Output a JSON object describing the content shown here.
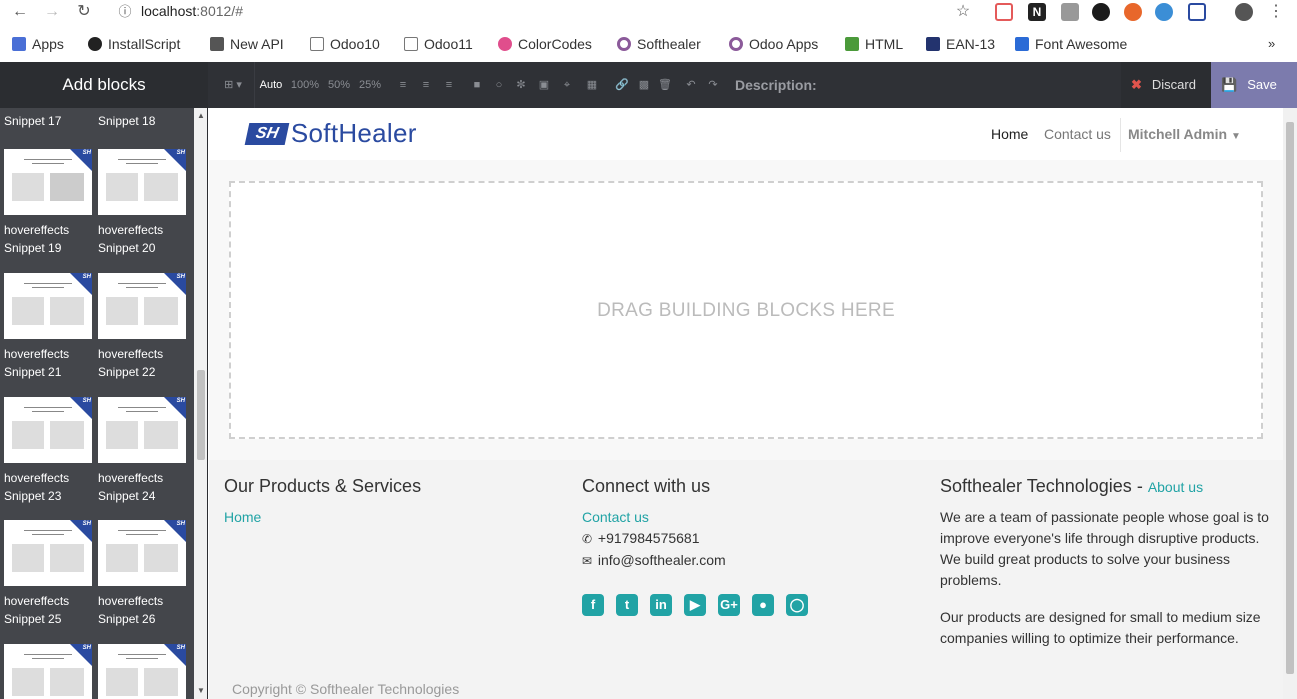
{
  "browser": {
    "url_host": "localhost",
    "url_path": ":8012/#",
    "bookmarks": [
      "Apps",
      "InstallScript",
      "New API",
      "Odoo10",
      "Odoo11",
      "ColorCodes",
      "Softhealer",
      "Odoo Apps",
      "HTML",
      "EAN-13",
      "Font Awesome"
    ]
  },
  "editor": {
    "add_blocks": "Add blocks",
    "size_auto": "Auto",
    "size_100": "100%",
    "size_50": "50%",
    "size_25": "25%",
    "description_label": "Description:",
    "discard": "Discard",
    "save": "Save"
  },
  "snippets": [
    {
      "l1": "hovereffects",
      "l2": "Snippet 17"
    },
    {
      "l1": "hovereffects",
      "l2": "Snippet 18"
    },
    {
      "l1": "hovereffects",
      "l2": "Snippet 19"
    },
    {
      "l1": "hovereffects",
      "l2": "Snippet 20"
    },
    {
      "l1": "hovereffects",
      "l2": "Snippet 21"
    },
    {
      "l1": "hovereffects",
      "l2": "Snippet 22"
    },
    {
      "l1": "hovereffects",
      "l2": "Snippet 23"
    },
    {
      "l1": "hovereffects",
      "l2": "Snippet 24"
    },
    {
      "l1": "hovereffects",
      "l2": "Snippet 25"
    },
    {
      "l1": "hovereffects",
      "l2": "Snippet 26"
    }
  ],
  "site": {
    "logo_mark": "SH",
    "logo_text": "SoftHealer",
    "nav_home": "Home",
    "nav_contact": "Contact us",
    "nav_user": "Mitchell Admin",
    "drop_text": "DRAG BUILDING BLOCKS HERE"
  },
  "footer": {
    "col1_title": "Our Products & Services",
    "col1_link": "Home",
    "col2_title": "Connect with us",
    "col2_link": "Contact us",
    "phone": "+917984575681",
    "email": "info@softhealer.com",
    "col3_title": "Softhealer Technologies",
    "col3_dash": " - ",
    "col3_about": "About us",
    "col3_p1": "We are a team of passionate people whose goal is to improve everyone's life through disruptive products. We build great products to solve your business problems.",
    "col3_p2": "Our products are designed for small to medium size companies willing to optimize their performance.",
    "copyright": "Copyright © Softhealer Technologies"
  },
  "colors": {
    "accent_teal": "#21a3a5",
    "save_purple": "#7c7bad",
    "brand_blue": "#2a4aa0"
  }
}
